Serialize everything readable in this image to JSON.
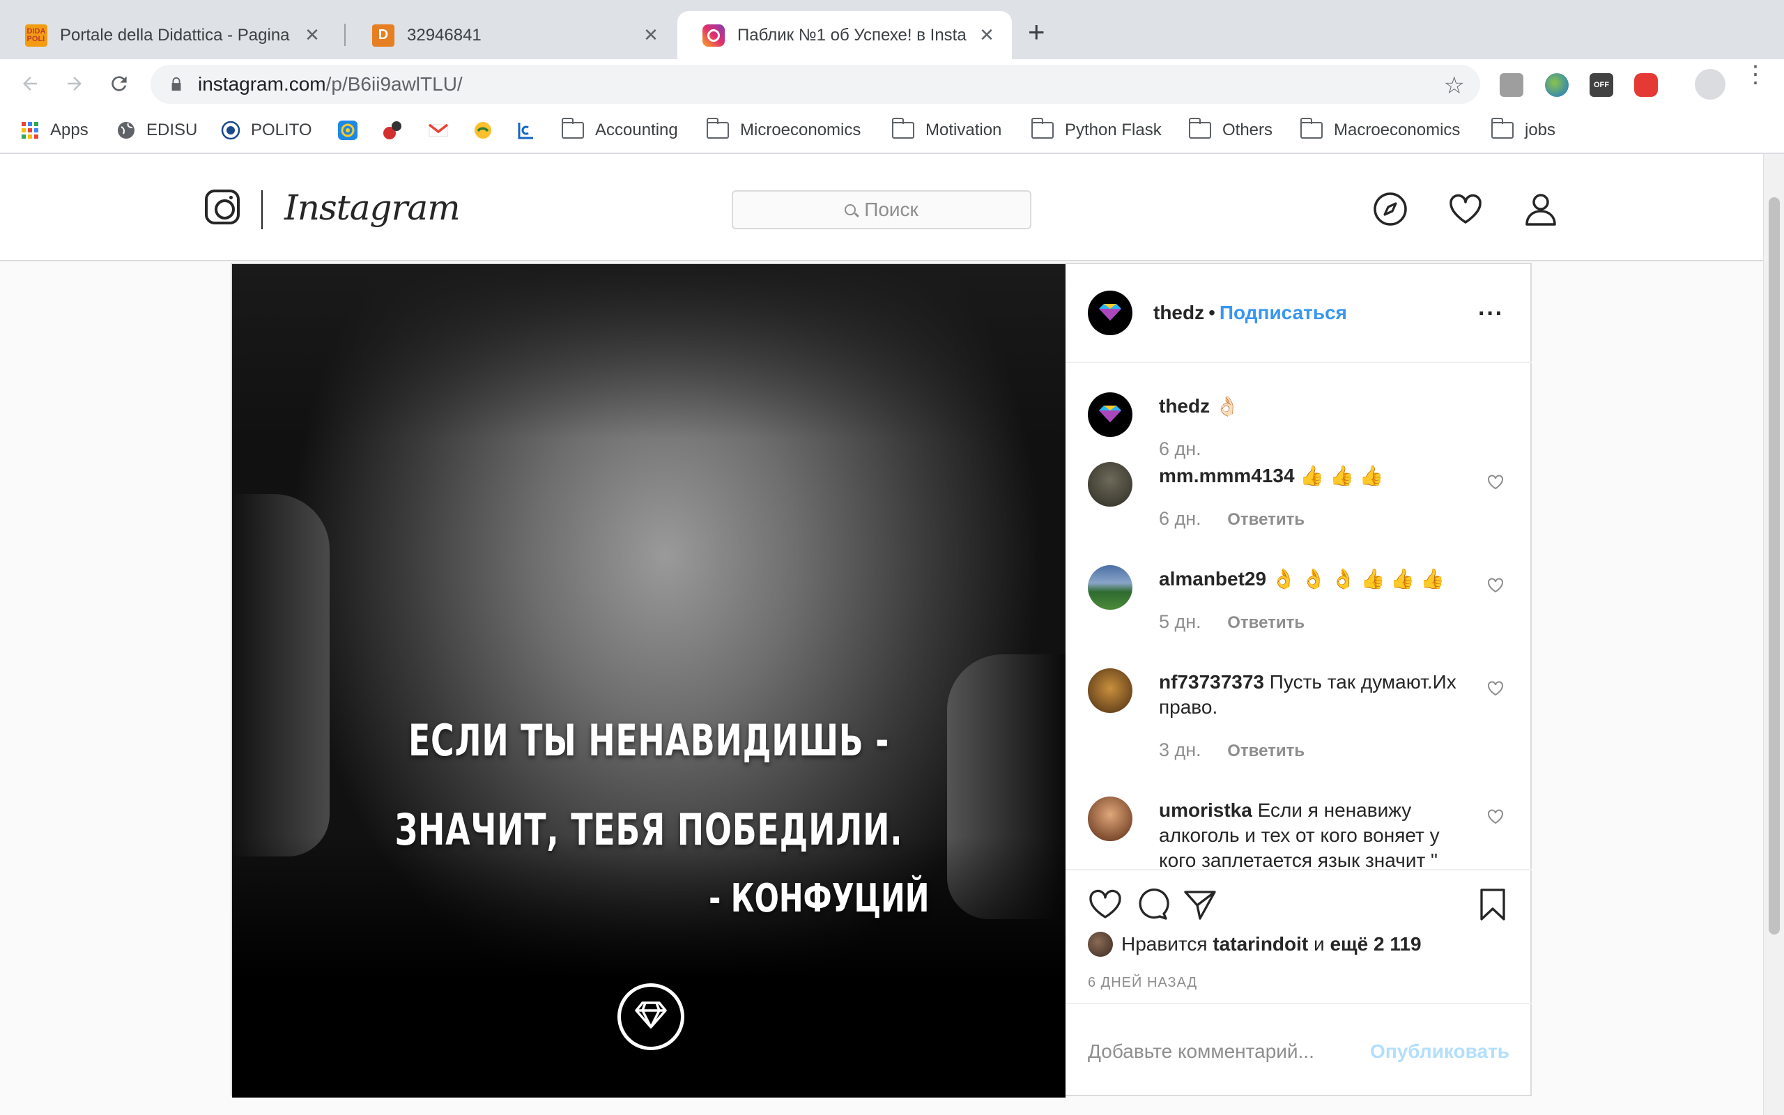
{
  "browser": {
    "tabs": [
      {
        "title": "Portale della Didattica - Pagina",
        "favicon": "polito-didattica-icon",
        "active": false
      },
      {
        "title": "32946841",
        "favicon": "d-letter-icon",
        "active": false
      },
      {
        "title": "Паблик №1 об Успехе! в Insta",
        "favicon": "instagram-icon",
        "active": true
      }
    ],
    "url_host": "instagram.com",
    "url_path": "/p/B6ii9awlTLU/",
    "bookmarks": [
      {
        "label": "Apps",
        "icon": "apps-grid-icon"
      },
      {
        "label": "EDISU",
        "icon": "globe-icon"
      },
      {
        "label": "POLITO",
        "icon": "polito-seal-icon"
      },
      {
        "label": "",
        "icon": "at-sign-icon"
      },
      {
        "label": "",
        "icon": "antivirus-icon"
      },
      {
        "label": "",
        "icon": "gmail-icon"
      },
      {
        "label": "",
        "icon": "currency-icon"
      },
      {
        "label": "",
        "icon": "c-bracket-icon"
      },
      {
        "label": "Accounting",
        "icon": "folder-icon"
      },
      {
        "label": "Microeconomics",
        "icon": "folder-icon"
      },
      {
        "label": "Motivation",
        "icon": "folder-icon"
      },
      {
        "label": "Python Flask",
        "icon": "folder-icon"
      },
      {
        "label": "Others",
        "icon": "folder-icon"
      },
      {
        "label": "Macroeconomics",
        "icon": "folder-icon"
      },
      {
        "label": "jobs",
        "icon": "folder-icon"
      }
    ]
  },
  "instagram": {
    "wordmark": "Instagram",
    "search_placeholder": "Поиск",
    "post": {
      "quote_line1": "ЕСЛИ ТЫ НЕНАВИДИШЬ -",
      "quote_line2": "ЗНАЧИТ, ТЕБЯ ПОБЕДИЛИ.",
      "quote_author": "- КОНФУЦИЙ",
      "author": "thedz",
      "follow_label": "Подписаться",
      "caption": {
        "user": "thedz",
        "text": "👌🏻",
        "time": "6 дн."
      },
      "comments": [
        {
          "user": "mm.mmm4134",
          "text": "👍 👍 👍",
          "time": "6 дн.",
          "reply": "Ответить"
        },
        {
          "user": "almanbet29",
          "text": "👌 👌 👌 👍 👍 👍",
          "time": "5 дн.",
          "reply": "Ответить"
        },
        {
          "user": "nf73737373",
          "text": "Пусть так думают.Их право.",
          "time": "3 дн.",
          "reply": "Ответить"
        },
        {
          "user": "umoristka",
          "text": "Если я ненавижу алкоголь и тех от кого воняет у кого заплетается язык значит \"",
          "time": "",
          "reply": ""
        }
      ],
      "likes_prefix": "Нравится",
      "likes_user": "tatarindoit",
      "likes_mid": "и",
      "likes_rest": "ещё 2 119",
      "posted_ago": "6 ДНЕЙ НАЗАД",
      "comment_placeholder": "Добавьте комментарий...",
      "publish_label": "Опубликовать"
    }
  },
  "colors": {
    "link_blue": "#3897f0",
    "publish_disabled": "#b2dffc",
    "secondary_text": "#8e8e8e"
  }
}
